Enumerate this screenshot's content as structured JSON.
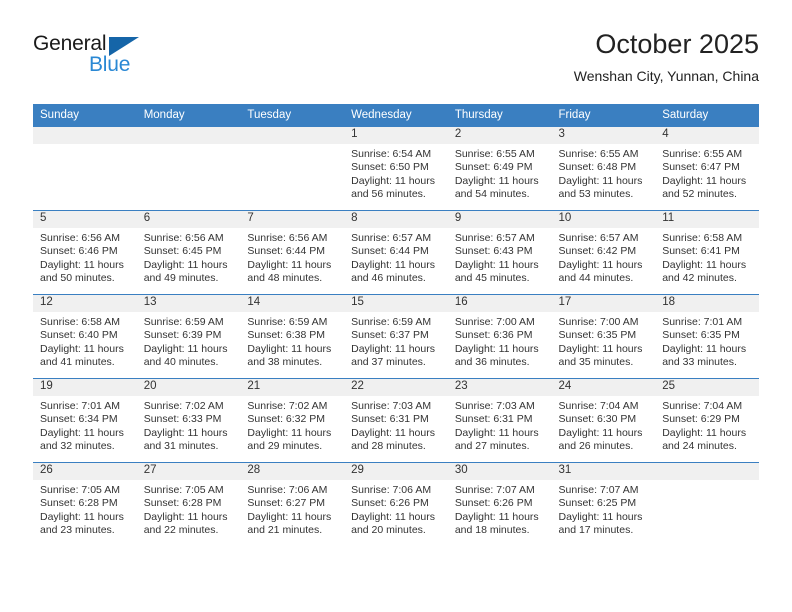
{
  "brand": {
    "name_primary": "General",
    "name_secondary": "Blue",
    "flag_color": "#1565a8",
    "secondary_color": "#2a88d4"
  },
  "header": {
    "title": "October 2025",
    "subtitle": "Wenshan City, Yunnan, China"
  },
  "theme": {
    "header_row_bg": "#3a7fc1",
    "daynum_band_bg": "#f0f0f0",
    "grid_line": "#3a7fc1",
    "text": "#333333"
  },
  "weekday_headers": [
    "Sunday",
    "Monday",
    "Tuesday",
    "Wednesday",
    "Thursday",
    "Friday",
    "Saturday"
  ],
  "weeks": [
    [
      {
        "day": "",
        "sunrise": "",
        "sunset": "",
        "daylight_line1": "",
        "daylight_line2": "",
        "empty": true
      },
      {
        "day": "",
        "sunrise": "",
        "sunset": "",
        "daylight_line1": "",
        "daylight_line2": "",
        "empty": true
      },
      {
        "day": "",
        "sunrise": "",
        "sunset": "",
        "daylight_line1": "",
        "daylight_line2": "",
        "empty": true
      },
      {
        "day": "1",
        "sunrise": "Sunrise: 6:54 AM",
        "sunset": "Sunset: 6:50 PM",
        "daylight_line1": "Daylight: 11 hours",
        "daylight_line2": "and 56 minutes.",
        "empty": false
      },
      {
        "day": "2",
        "sunrise": "Sunrise: 6:55 AM",
        "sunset": "Sunset: 6:49 PM",
        "daylight_line1": "Daylight: 11 hours",
        "daylight_line2": "and 54 minutes.",
        "empty": false
      },
      {
        "day": "3",
        "sunrise": "Sunrise: 6:55 AM",
        "sunset": "Sunset: 6:48 PM",
        "daylight_line1": "Daylight: 11 hours",
        "daylight_line2": "and 53 minutes.",
        "empty": false
      },
      {
        "day": "4",
        "sunrise": "Sunrise: 6:55 AM",
        "sunset": "Sunset: 6:47 PM",
        "daylight_line1": "Daylight: 11 hours",
        "daylight_line2": "and 52 minutes.",
        "empty": false
      }
    ],
    [
      {
        "day": "5",
        "sunrise": "Sunrise: 6:56 AM",
        "sunset": "Sunset: 6:46 PM",
        "daylight_line1": "Daylight: 11 hours",
        "daylight_line2": "and 50 minutes.",
        "empty": false
      },
      {
        "day": "6",
        "sunrise": "Sunrise: 6:56 AM",
        "sunset": "Sunset: 6:45 PM",
        "daylight_line1": "Daylight: 11 hours",
        "daylight_line2": "and 49 minutes.",
        "empty": false
      },
      {
        "day": "7",
        "sunrise": "Sunrise: 6:56 AM",
        "sunset": "Sunset: 6:44 PM",
        "daylight_line1": "Daylight: 11 hours",
        "daylight_line2": "and 48 minutes.",
        "empty": false
      },
      {
        "day": "8",
        "sunrise": "Sunrise: 6:57 AM",
        "sunset": "Sunset: 6:44 PM",
        "daylight_line1": "Daylight: 11 hours",
        "daylight_line2": "and 46 minutes.",
        "empty": false
      },
      {
        "day": "9",
        "sunrise": "Sunrise: 6:57 AM",
        "sunset": "Sunset: 6:43 PM",
        "daylight_line1": "Daylight: 11 hours",
        "daylight_line2": "and 45 minutes.",
        "empty": false
      },
      {
        "day": "10",
        "sunrise": "Sunrise: 6:57 AM",
        "sunset": "Sunset: 6:42 PM",
        "daylight_line1": "Daylight: 11 hours",
        "daylight_line2": "and 44 minutes.",
        "empty": false
      },
      {
        "day": "11",
        "sunrise": "Sunrise: 6:58 AM",
        "sunset": "Sunset: 6:41 PM",
        "daylight_line1": "Daylight: 11 hours",
        "daylight_line2": "and 42 minutes.",
        "empty": false
      }
    ],
    [
      {
        "day": "12",
        "sunrise": "Sunrise: 6:58 AM",
        "sunset": "Sunset: 6:40 PM",
        "daylight_line1": "Daylight: 11 hours",
        "daylight_line2": "and 41 minutes.",
        "empty": false
      },
      {
        "day": "13",
        "sunrise": "Sunrise: 6:59 AM",
        "sunset": "Sunset: 6:39 PM",
        "daylight_line1": "Daylight: 11 hours",
        "daylight_line2": "and 40 minutes.",
        "empty": false
      },
      {
        "day": "14",
        "sunrise": "Sunrise: 6:59 AM",
        "sunset": "Sunset: 6:38 PM",
        "daylight_line1": "Daylight: 11 hours",
        "daylight_line2": "and 38 minutes.",
        "empty": false
      },
      {
        "day": "15",
        "sunrise": "Sunrise: 6:59 AM",
        "sunset": "Sunset: 6:37 PM",
        "daylight_line1": "Daylight: 11 hours",
        "daylight_line2": "and 37 minutes.",
        "empty": false
      },
      {
        "day": "16",
        "sunrise": "Sunrise: 7:00 AM",
        "sunset": "Sunset: 6:36 PM",
        "daylight_line1": "Daylight: 11 hours",
        "daylight_line2": "and 36 minutes.",
        "empty": false
      },
      {
        "day": "17",
        "sunrise": "Sunrise: 7:00 AM",
        "sunset": "Sunset: 6:35 PM",
        "daylight_line1": "Daylight: 11 hours",
        "daylight_line2": "and 35 minutes.",
        "empty": false
      },
      {
        "day": "18",
        "sunrise": "Sunrise: 7:01 AM",
        "sunset": "Sunset: 6:35 PM",
        "daylight_line1": "Daylight: 11 hours",
        "daylight_line2": "and 33 minutes.",
        "empty": false
      }
    ],
    [
      {
        "day": "19",
        "sunrise": "Sunrise: 7:01 AM",
        "sunset": "Sunset: 6:34 PM",
        "daylight_line1": "Daylight: 11 hours",
        "daylight_line2": "and 32 minutes.",
        "empty": false
      },
      {
        "day": "20",
        "sunrise": "Sunrise: 7:02 AM",
        "sunset": "Sunset: 6:33 PM",
        "daylight_line1": "Daylight: 11 hours",
        "daylight_line2": "and 31 minutes.",
        "empty": false
      },
      {
        "day": "21",
        "sunrise": "Sunrise: 7:02 AM",
        "sunset": "Sunset: 6:32 PM",
        "daylight_line1": "Daylight: 11 hours",
        "daylight_line2": "and 29 minutes.",
        "empty": false
      },
      {
        "day": "22",
        "sunrise": "Sunrise: 7:03 AM",
        "sunset": "Sunset: 6:31 PM",
        "daylight_line1": "Daylight: 11 hours",
        "daylight_line2": "and 28 minutes.",
        "empty": false
      },
      {
        "day": "23",
        "sunrise": "Sunrise: 7:03 AM",
        "sunset": "Sunset: 6:31 PM",
        "daylight_line1": "Daylight: 11 hours",
        "daylight_line2": "and 27 minutes.",
        "empty": false
      },
      {
        "day": "24",
        "sunrise": "Sunrise: 7:04 AM",
        "sunset": "Sunset: 6:30 PM",
        "daylight_line1": "Daylight: 11 hours",
        "daylight_line2": "and 26 minutes.",
        "empty": false
      },
      {
        "day": "25",
        "sunrise": "Sunrise: 7:04 AM",
        "sunset": "Sunset: 6:29 PM",
        "daylight_line1": "Daylight: 11 hours",
        "daylight_line2": "and 24 minutes.",
        "empty": false
      }
    ],
    [
      {
        "day": "26",
        "sunrise": "Sunrise: 7:05 AM",
        "sunset": "Sunset: 6:28 PM",
        "daylight_line1": "Daylight: 11 hours",
        "daylight_line2": "and 23 minutes.",
        "empty": false
      },
      {
        "day": "27",
        "sunrise": "Sunrise: 7:05 AM",
        "sunset": "Sunset: 6:28 PM",
        "daylight_line1": "Daylight: 11 hours",
        "daylight_line2": "and 22 minutes.",
        "empty": false
      },
      {
        "day": "28",
        "sunrise": "Sunrise: 7:06 AM",
        "sunset": "Sunset: 6:27 PM",
        "daylight_line1": "Daylight: 11 hours",
        "daylight_line2": "and 21 minutes.",
        "empty": false
      },
      {
        "day": "29",
        "sunrise": "Sunrise: 7:06 AM",
        "sunset": "Sunset: 6:26 PM",
        "daylight_line1": "Daylight: 11 hours",
        "daylight_line2": "and 20 minutes.",
        "empty": false
      },
      {
        "day": "30",
        "sunrise": "Sunrise: 7:07 AM",
        "sunset": "Sunset: 6:26 PM",
        "daylight_line1": "Daylight: 11 hours",
        "daylight_line2": "and 18 minutes.",
        "empty": false
      },
      {
        "day": "31",
        "sunrise": "Sunrise: 7:07 AM",
        "sunset": "Sunset: 6:25 PM",
        "daylight_line1": "Daylight: 11 hours",
        "daylight_line2": "and 17 minutes.",
        "empty": false
      },
      {
        "day": "",
        "sunrise": "",
        "sunset": "",
        "daylight_line1": "",
        "daylight_line2": "",
        "empty": true
      }
    ]
  ]
}
